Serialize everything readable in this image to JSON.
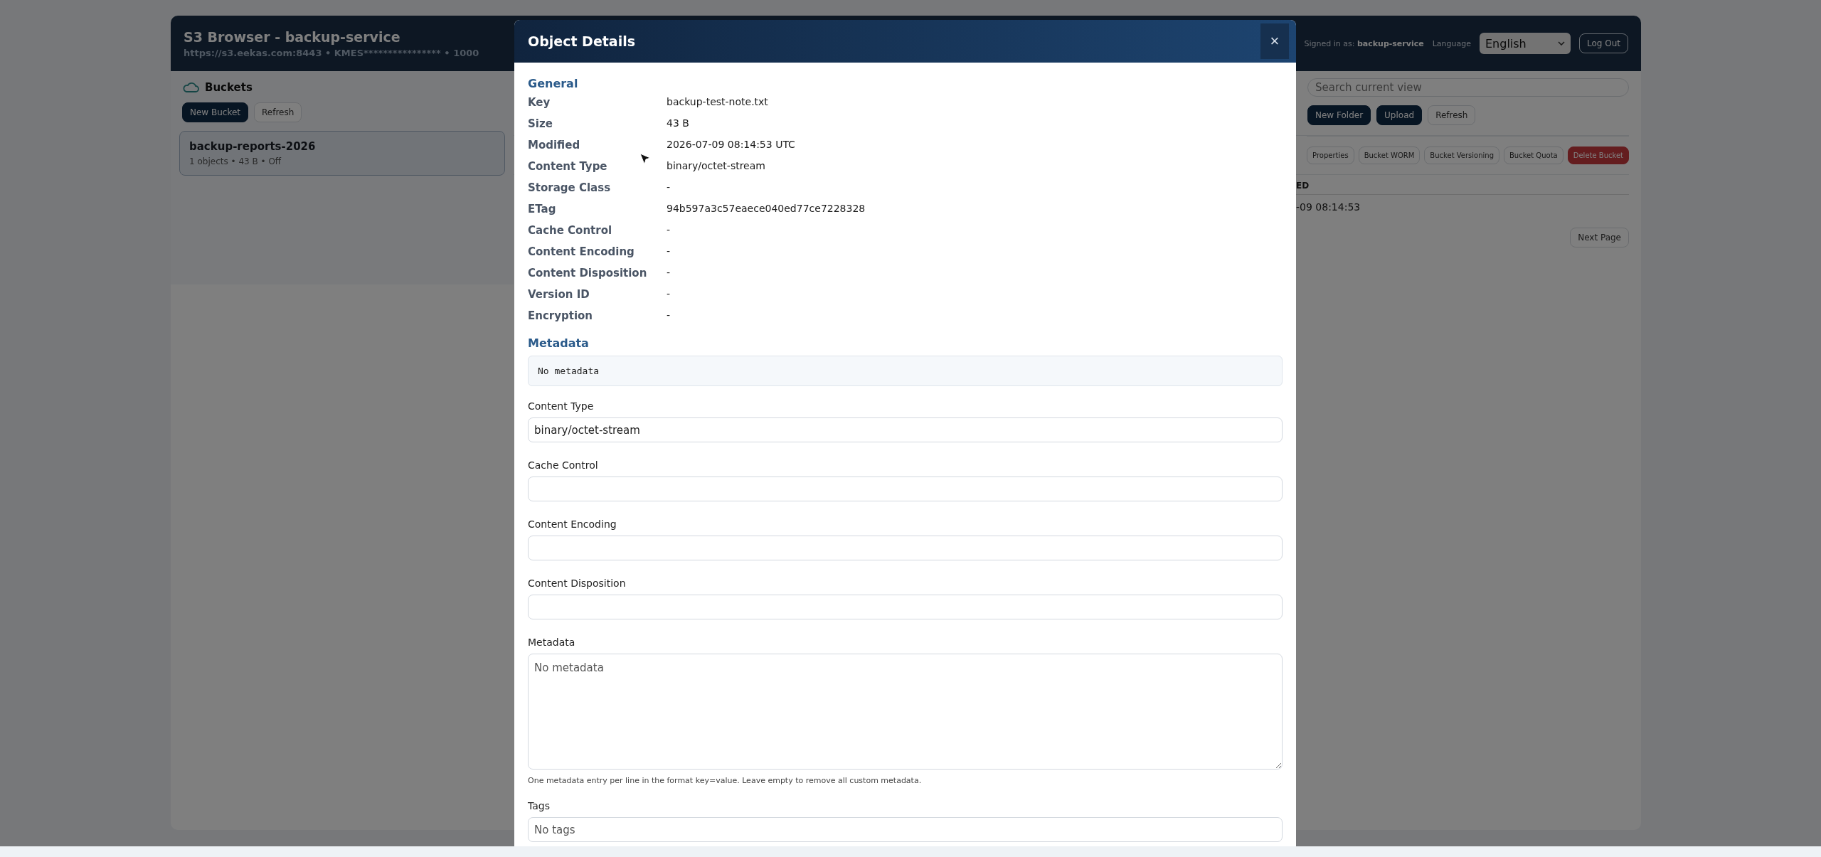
{
  "header": {
    "title": "S3 Browser - backup-service",
    "subtitle": "https://s3.eekas.com:8443 • KMES**************** • 1000",
    "signed_in": "Signed in as: **backup-service**",
    "language_label": "Language",
    "language": "English",
    "logout": "Log Out"
  },
  "sidebar": {
    "title": "Buckets",
    "buttons": [
      {
        "label": "New Bucket",
        "kind": "primary"
      },
      {
        "label": "Refresh",
        "kind": "secondary"
      }
    ],
    "buckets": [
      {
        "name": "backup-reports-2026",
        "info": "1 objects • 43 B • Off",
        "selected": true
      }
    ]
  },
  "content": {
    "search": {
      "placeholder": "Search current view"
    },
    "toolbar": [
      {
        "label": "New Folder",
        "kind": "primary"
      },
      {
        "label": "Upload",
        "kind": "primary"
      },
      {
        "label": "Refresh",
        "kind": "secondary"
      }
    ],
    "bucket_actions": [
      {
        "label": "Properties",
        "kind": "secondary"
      },
      {
        "label": "Bucket WORM",
        "kind": "secondary"
      },
      {
        "label": "Bucket Versioning",
        "kind": "secondary"
      },
      {
        "label": "Bucket Quota",
        "kind": "secondary"
      },
      {
        "label": "Delete Bucket",
        "kind": "danger"
      }
    ],
    "table": {
      "columns": [
        "ED"
      ],
      "rows": [
        [
          "-09 08:14:53"
        ]
      ]
    },
    "next_page": "Next Page"
  },
  "modal": {
    "title": "Object Details",
    "close": "×",
    "general_title": "General",
    "properties": [
      {
        "label": "Key",
        "value": "backup-test-note.txt"
      },
      {
        "label": "Size",
        "value": "43 B"
      },
      {
        "label": "Modified",
        "value": "2026-07-09 08:14:53 UTC"
      },
      {
        "label": "Content Type",
        "value": "binary/octet-stream"
      },
      {
        "label": "Storage Class",
        "value": "-"
      },
      {
        "label": "ETag",
        "value": "94b597a3c57eaece040ed77ce7228328"
      },
      {
        "label": "Cache Control",
        "value": "-"
      },
      {
        "label": "Content Encoding",
        "value": "-"
      },
      {
        "label": "Content Disposition",
        "value": "-"
      },
      {
        "label": "Version ID",
        "value": "-"
      },
      {
        "label": "Encryption",
        "value": "-"
      }
    ],
    "metadata_title": "Metadata",
    "metadata_preview": "No metadata",
    "fields": [
      {
        "kind": "input",
        "label": "Content Type",
        "value": "binary/octet-stream"
      },
      {
        "kind": "input",
        "label": "Cache Control"
      },
      {
        "kind": "input",
        "label": "Content Encoding"
      },
      {
        "kind": "input",
        "label": "Content Disposition"
      },
      {
        "kind": "textarea",
        "label": "Metadata",
        "placeholder": "No metadata",
        "help": "One metadata entry per line in the format key=value. Leave empty to remove all custom metadata."
      },
      {
        "kind": "input",
        "label": "Tags",
        "placeholder": "No tags"
      }
    ]
  }
}
